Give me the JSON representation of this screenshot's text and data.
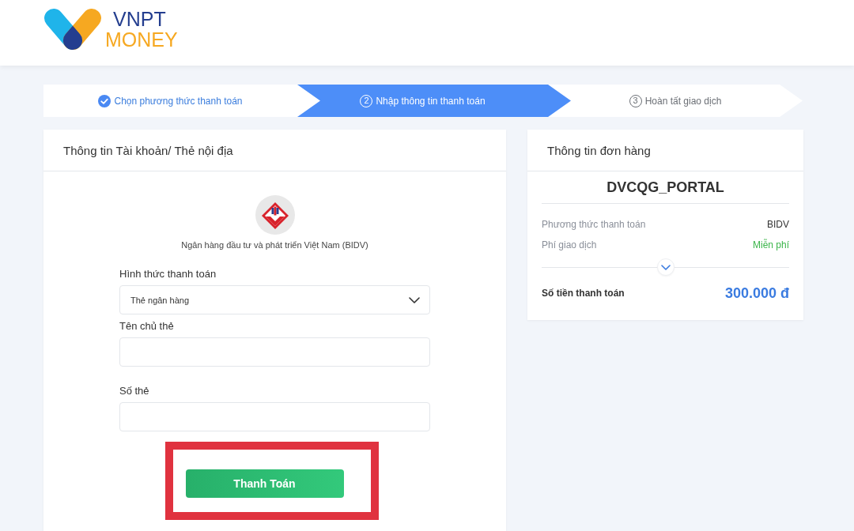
{
  "header": {
    "logo": {
      "wordmark": [
        "VNPT",
        "MONEY"
      ]
    }
  },
  "steps": [
    {
      "label": "Chọn phương thức thanh toán",
      "done": true,
      "current": false
    },
    {
      "number": "2",
      "label": "Nhập thông tin thanh toán",
      "done": false,
      "current": true
    },
    {
      "number": "3",
      "label": "Hoàn tất giao dịch",
      "done": false,
      "current": false
    }
  ],
  "account_card": {
    "title": "Thông tin Tài khoản/ Thẻ nội địa",
    "bank_name": "Ngân hàng đầu tư và phát triển Việt Nam (BIDV)",
    "fields": [
      {
        "kind": "select",
        "label": "Hình thức thanh toán",
        "value": "Thẻ ngân hàng"
      },
      {
        "kind": "text",
        "label": "Tên chủ thẻ"
      },
      {
        "kind": "text",
        "label": "Số thẻ"
      }
    ],
    "submit": {
      "label": "Thanh Toán",
      "highlighted": true
    }
  },
  "order_card": {
    "title": "Thông tin đơn hàng",
    "merchant": "DVCQG_PORTAL",
    "rows": [
      {
        "kind": "plain",
        "label": "Phương thức thanh toán",
        "value": "BIDV"
      },
      {
        "kind": "free",
        "label": "Phí giao dịch",
        "value": "Miễn phí"
      }
    ],
    "total": {
      "label": "Số tiền thanh toán",
      "value": "300.000 đ"
    }
  }
}
